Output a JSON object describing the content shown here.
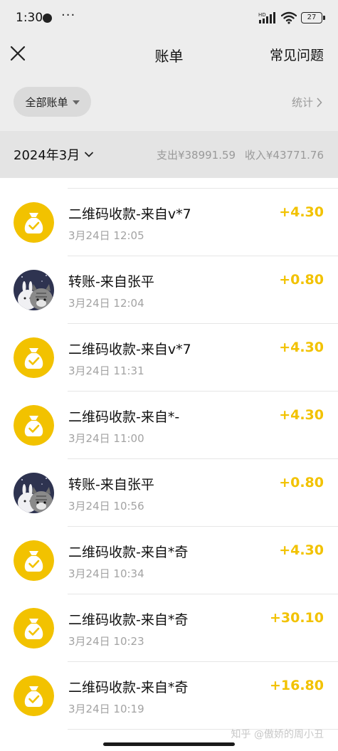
{
  "status_bar": {
    "time": "1:30",
    "more": "···",
    "network_label": "HD",
    "battery": "27"
  },
  "nav": {
    "title": "账单",
    "faq_label": "常见问题"
  },
  "filter": {
    "all_bills_label": "全部账单",
    "stats_label": "统计"
  },
  "month": {
    "label": "2024年3月",
    "expense": "支出¥38991.59",
    "income": "收入¥43771.76"
  },
  "transactions": [
    {
      "title": "二维码收款-来自v*7",
      "time": "3月24日 12:05",
      "amount": "+4.30",
      "icon": "money-bag-icon"
    },
    {
      "title": "转账-来自张平",
      "time": "3月24日 12:04",
      "amount": "+0.80",
      "icon": "cartoon-avatar"
    },
    {
      "title": "二维码收款-来自v*7",
      "time": "3月24日 11:31",
      "amount": "+4.30",
      "icon": "money-bag-icon"
    },
    {
      "title": "二维码收款-来自*-",
      "time": "3月24日 11:00",
      "amount": "+4.30",
      "icon": "money-bag-icon"
    },
    {
      "title": "转账-来自张平",
      "time": "3月24日 10:56",
      "amount": "+0.80",
      "icon": "cartoon-avatar"
    },
    {
      "title": "二维码收款-来自*奇",
      "time": "3月24日 10:34",
      "amount": "+4.30",
      "icon": "money-bag-icon"
    },
    {
      "title": "二维码收款-来自*奇",
      "time": "3月24日 10:23",
      "amount": "+30.10",
      "icon": "money-bag-icon"
    },
    {
      "title": "二维码收款-来自*奇",
      "time": "3月24日 10:19",
      "amount": "+16.80",
      "icon": "money-bag-icon"
    }
  ],
  "watermark": "知乎 @傲娇的周小丑",
  "colors": {
    "accent": "#f2c200",
    "page_bg": "#ededed",
    "muted_text": "#9a9a9a"
  }
}
